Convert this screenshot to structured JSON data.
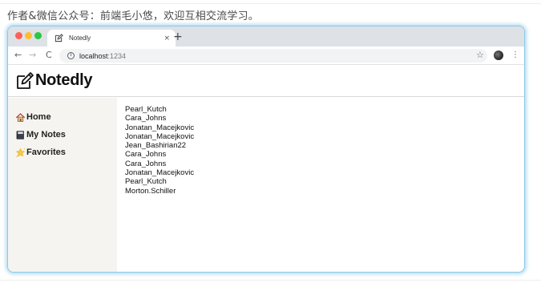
{
  "caption": "作者&微信公众号：前端毛小悠，欢迎互相交流学习。",
  "browser": {
    "tab": {
      "title": "Notedly",
      "favicon": "pencil-square-icon",
      "close": "×"
    },
    "new_tab": "+",
    "nav": {
      "back": "←",
      "forward": "→",
      "reload": "C"
    },
    "address": {
      "host": "localhost",
      "port": ":1234",
      "icon": "info-icon",
      "info_glyph": "i"
    },
    "star": "☆",
    "menu": "⋮"
  },
  "app": {
    "title": "Notedly",
    "logo": "pencil-square-icon"
  },
  "sidebar": {
    "items": [
      {
        "label": "Home",
        "icon": "house-icon"
      },
      {
        "label": "My Notes",
        "icon": "notebook-icon"
      },
      {
        "label": "Favorites",
        "icon": "star-icon"
      }
    ]
  },
  "notes": [
    "Pearl_Kutch",
    "Cara_Johns",
    "Jonatan_Macejkovic",
    "Jonatan_Macejkovic",
    "Jean_Bashirian22",
    "Cara_Johns",
    "Cara_Johns",
    "Jonatan_Macejkovic",
    "Pearl_Kutch",
    "Morton.Schiller"
  ],
  "colors": {
    "tabbar": "#dee1e6",
    "sidebar": "#f5f4f0",
    "frame_glow": "#8ec9e8"
  }
}
